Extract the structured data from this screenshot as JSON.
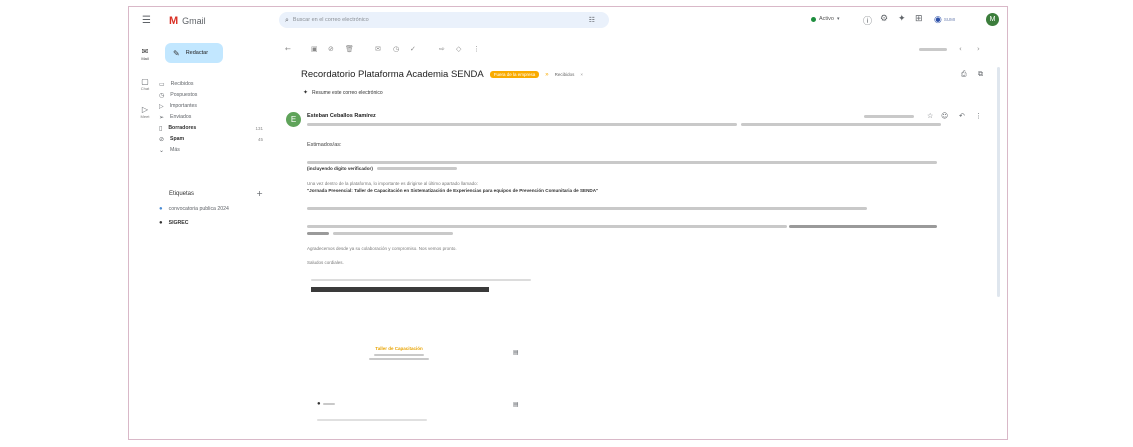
{
  "app": {
    "name": "Gmail"
  },
  "search": {
    "placeholder": "Buscar en el correo electrónico"
  },
  "status": {
    "label": "Activo"
  },
  "account": {
    "avatar_letter": "M",
    "workspace_label": "SUMI"
  },
  "compose": {
    "label": "Redactar"
  },
  "rail": {
    "mail_label": "Mail",
    "chat_label": "Chat",
    "meet_label": "Meet"
  },
  "sidebar": {
    "items": [
      {
        "label": "Recibidos"
      },
      {
        "label": "Pospuestos"
      },
      {
        "label": "Importantes"
      },
      {
        "label": "Enviados"
      },
      {
        "label": "Borradores",
        "count": "131"
      },
      {
        "label": "Spam",
        "count": "45"
      },
      {
        "label": "Más"
      }
    ],
    "labels_header": "Etiquetas",
    "labels": [
      {
        "label": "convocatoria publica 2024"
      },
      {
        "label": "SIGREC"
      }
    ]
  },
  "message": {
    "subject": "Recordatorio Plataforma Academia SENDA",
    "external_badge": "Fuera de la empresa",
    "inbox_chip": "Recibidos",
    "summary_label": "Resume este correo electrónico",
    "sender": "Esteban Ceballos Ramírez",
    "body": {
      "greeting": "Estimados/as:",
      "p1_bold": "(incluyendo dígito verificador)",
      "p2_line1": "Una vez dentro de la plataforma, lo importante es dirigirse al último apartado llamado:",
      "course_title": "\"Jornada Presencial: Taller de Capacitación en Sistematización de Experiencias para equipos de Prevención Comunitaria de SENDA\"",
      "p5": "Agradecemos desde ya su colaboración y compromiso. Nos vemos pronto.",
      "closing": "Saludos cordiales."
    },
    "attachment": {
      "title": "Taller de Capacitación"
    }
  },
  "colors": {
    "gmail_red": "#d93025",
    "compose_bg": "#c2e7ff",
    "badge_bg": "#f9ab00",
    "sender_avatar": "#5fa35a",
    "account_avatar": "#3c7d3c",
    "active_dot": "#1e8e3e"
  }
}
